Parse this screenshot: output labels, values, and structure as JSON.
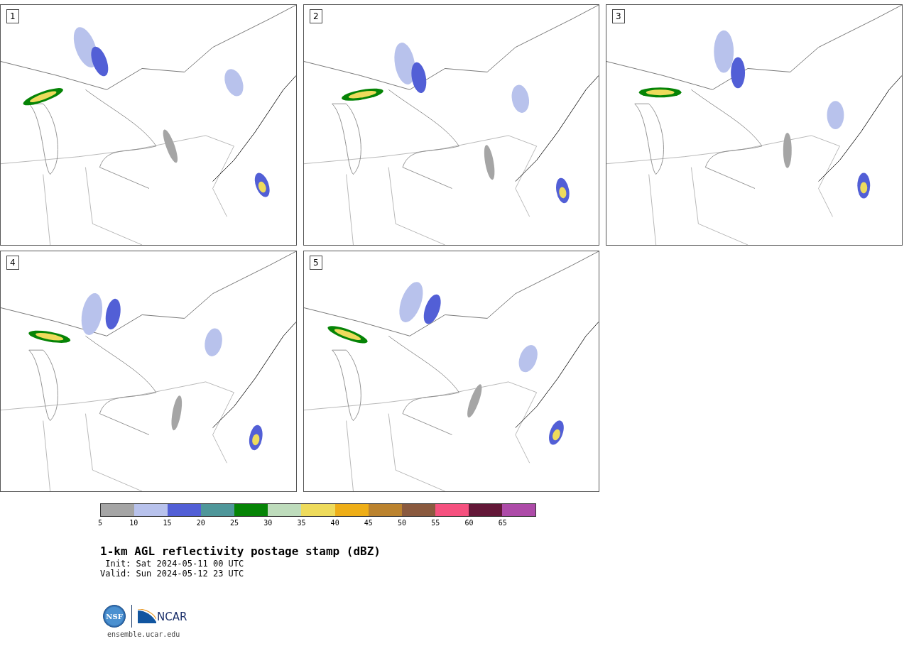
{
  "maps": [
    {
      "label": "1",
      "kind": "picture"
    },
    {
      "label": "2",
      "kind": "picture"
    },
    {
      "label": "3",
      "kind": "picture"
    },
    {
      "label": "4",
      "kind": "picture"
    },
    {
      "label": "5",
      "kind": "picture"
    }
  ],
  "colorbar": {
    "bins": [
      {
        "color": "#a5a5a5"
      },
      {
        "color": "#b8c2ec"
      },
      {
        "color": "#525fd6"
      },
      {
        "color": "#4f979a"
      },
      {
        "color": "#068406"
      },
      {
        "color": "#bedcbc"
      },
      {
        "color": "#eedb5c"
      },
      {
        "color": "#eeae17"
      },
      {
        "color": "#bb832f"
      },
      {
        "color": "#8a5a3f"
      },
      {
        "color": "#f5517f"
      },
      {
        "color": "#631838"
      },
      {
        "color": "#ad4ba8"
      }
    ],
    "ticks": [
      "5",
      "10",
      "15",
      "20",
      "25",
      "30",
      "35",
      "40",
      "45",
      "50",
      "55",
      "60",
      "65"
    ]
  },
  "title": "1-km AGL reflectivity postage stamp (dBZ)",
  "init": " Init: Sat 2024-05-11 00 UTC",
  "valid": "Valid: Sun 2024-05-12 23 UTC",
  "logo": {
    "left": "NSF",
    "right": "NCAR"
  },
  "site": "ensemble.ucar.edu"
}
